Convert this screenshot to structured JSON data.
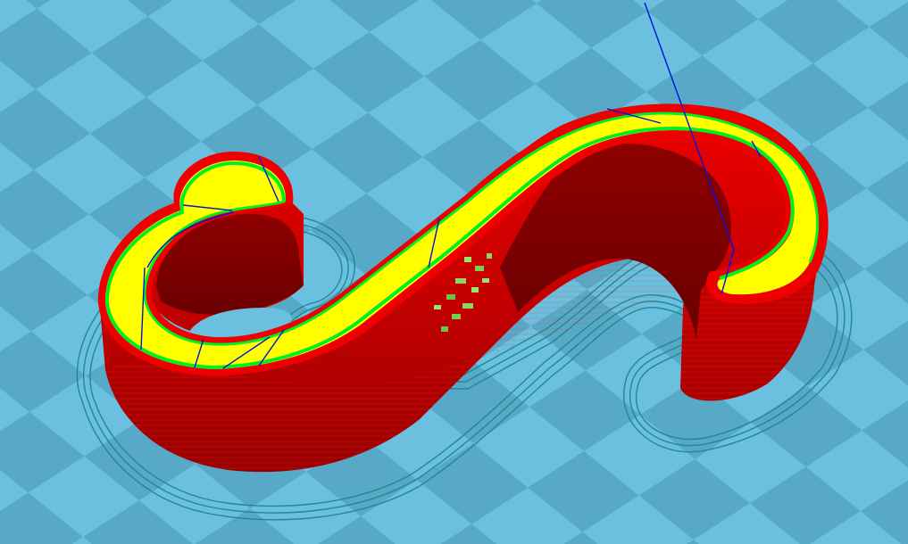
{
  "viewport": {
    "view": "gcode-layer-preview",
    "background": "build-plate-checkerboard"
  },
  "colors": {
    "plate_light": "#6bbfdf",
    "plate_dark": "#58a8c8",
    "wall_outer": "#ee0000",
    "wall_shade": "#b40000",
    "wall_dark": "#7e0000",
    "infill_top": "#ffff00",
    "inner_wall": "#00ee22",
    "travel": "#0011dd",
    "skirt": "#1f8a8f"
  },
  "features": {
    "model_shape": "s-hook-print",
    "skirt_loops": 3,
    "layer_lines": "visible",
    "travel_moves": "shown",
    "z_seam_markers": "shown"
  }
}
